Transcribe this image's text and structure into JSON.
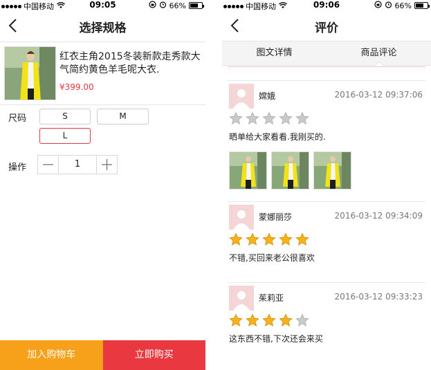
{
  "left": {
    "status": {
      "carrier": "中国移动",
      "time": "09:05",
      "battery": "66%"
    },
    "nav": {
      "title": "选择规格"
    },
    "product": {
      "name": "红衣主角2015冬装新款走秀款大气简约黄色羊毛呢大衣.",
      "price": "¥399.00"
    },
    "size": {
      "label": "尺码",
      "options": [
        "S",
        "M",
        "L"
      ],
      "selected": "L"
    },
    "quantity": {
      "label": "操作",
      "value": "1"
    },
    "bottom": {
      "add_cart": "加入购物车",
      "buy_now": "立即购买"
    },
    "colors": {
      "accent": "#e9353e",
      "cart": "#f7a01a",
      "buy": "#e9383f"
    }
  },
  "right": {
    "status": {
      "carrier": "中国移动",
      "time": "09:06",
      "battery": "66%"
    },
    "nav": {
      "title": "评价"
    },
    "tabs": [
      {
        "label": "图文详情"
      },
      {
        "label": "商品评论",
        "active": true
      }
    ],
    "reviews": [
      {
        "name": "嫦娥",
        "time": "2016-03-12 09:37:06",
        "rating": 0,
        "text": "晒单给大家看看.我刚买的.",
        "photos": 3
      },
      {
        "name": "蒙娜丽莎",
        "time": "2016-03-12 09:34:09",
        "rating": 5,
        "text": "不错,买回来老公很喜欢",
        "photos": 0
      },
      {
        "name": "茱莉亚",
        "time": "2016-03-12 09:33:23",
        "rating": 4,
        "text": "这东西不错,下次还会来买",
        "photos": 0
      }
    ]
  },
  "icons": [
    "back-icon",
    "wifi-icon",
    "alarm-icon",
    "lock-rotation-icon",
    "battery-icon",
    "star-icon",
    "minus-icon",
    "plus-icon",
    "avatar-placeholder-icon"
  ]
}
